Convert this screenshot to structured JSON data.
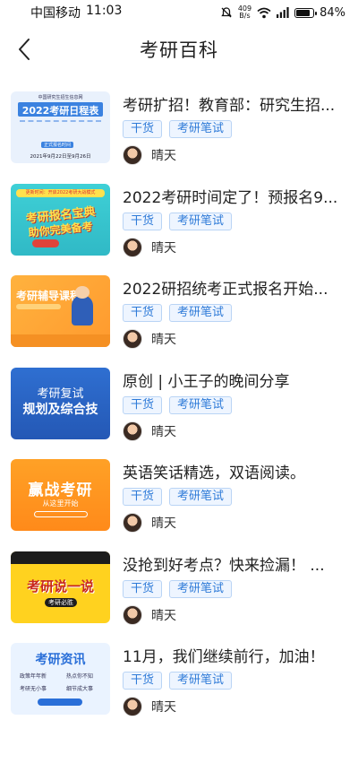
{
  "status_bar": {
    "carrier": "中国移动",
    "time": "11:03",
    "net_speed_value": "409",
    "net_speed_unit": "B/s",
    "battery": "84%",
    "battery_level": 0.84
  },
  "header": {
    "back_icon": "chevron-left-icon",
    "title": "考研百科"
  },
  "articles": [
    {
      "title": "考研扩招！教育部：研究生招...",
      "tags": [
        "干货",
        "考研笔试"
      ],
      "author": "晴天",
      "thumb": {
        "main": "2022考研日程表",
        "sub": "中国研究生招生信息网",
        "foot": "2021年9月22日至9月26日",
        "extra": "正式报名时间"
      }
    },
    {
      "title": "2022考研时间定了！预报名9...",
      "tags": [
        "干货",
        "考研笔试"
      ],
      "author": "晴天",
      "thumb": {
        "main": "考研报名宝典",
        "sub": "助你完美备考",
        "top": "更新时间：开启2022考研大战模式"
      }
    },
    {
      "title": "2022研招统考正式报名开始...",
      "tags": [
        "干货",
        "考研笔试"
      ],
      "author": "晴天",
      "thumb": {
        "main": "考研辅导课程"
      }
    },
    {
      "title": "原创 | 小王子的晚间分享",
      "tags": [
        "干货",
        "考研笔试"
      ],
      "author": "晴天",
      "thumb": {
        "main": "考研复试",
        "sub": "规划及综合技"
      }
    },
    {
      "title": "英语笑话精选，双语阅读。",
      "tags": [
        "干货",
        "考研笔试"
      ],
      "author": "晴天",
      "thumb": {
        "main": "赢战考研",
        "sub": "从这里开始"
      }
    },
    {
      "title": "没抢到好考点？快来捡漏！ ...",
      "tags": [
        "干货",
        "考研笔试"
      ],
      "author": "晴天",
      "thumb": {
        "main": "考研说一说",
        "sub": "考研必胜"
      }
    },
    {
      "title": "11月，我们继续前行，加油！",
      "tags": [
        "干货",
        "考研笔试"
      ],
      "author": "晴天",
      "thumb": {
        "main": "考研资讯",
        "items": [
          "政策年年新",
          "热点你不知",
          "考研无小事",
          "细节成大事"
        ]
      }
    }
  ]
}
